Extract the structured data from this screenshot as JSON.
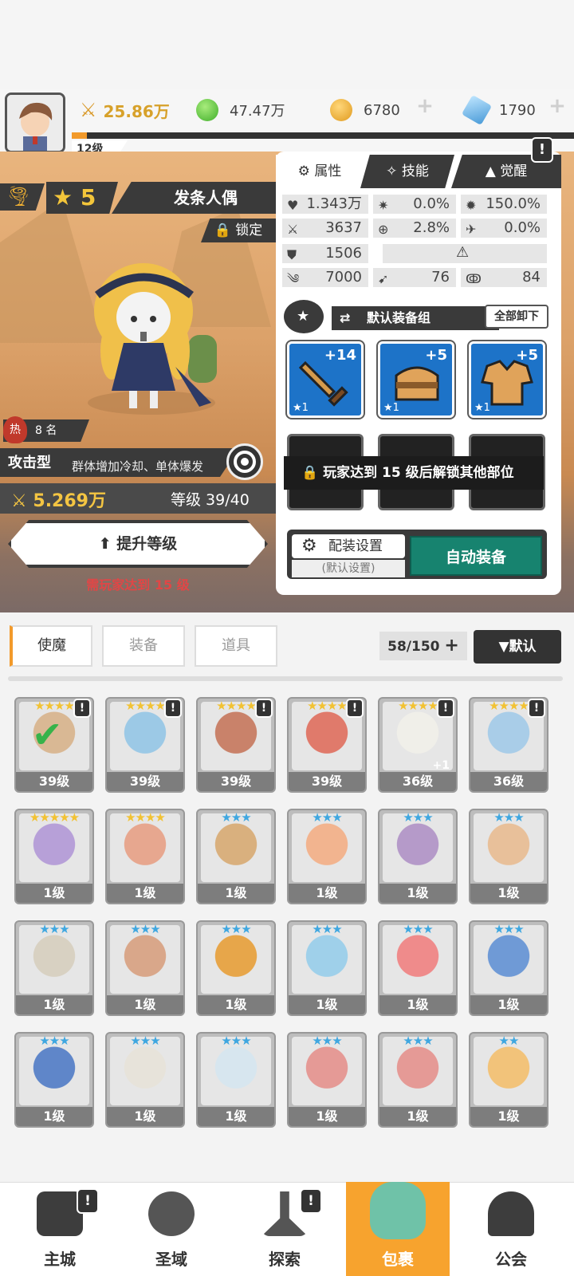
{
  "topbar": {
    "power": "25.86万",
    "gems": "47.47万",
    "gold": "6780",
    "diamond": "1790",
    "player_level": "12级",
    "xp_fraction": 0.03
  },
  "hero": {
    "star": "5",
    "name": "发条人偶",
    "lock_label": "锁定",
    "hot_rank": "8 名",
    "hot_label": "热",
    "type_label": "攻击型",
    "type_desc": "群体增加冷却、单体爆发",
    "power": "5.269万",
    "level_text": "等级 39/40",
    "upgrade_label": "提升等级",
    "upgrade_hint": "需玩家达到 15 级"
  },
  "panel": {
    "tabs": [
      "属性",
      "技能",
      "觉醒"
    ],
    "stats": {
      "hp": "1.343万",
      "s1": "0.0%",
      "s2": "150.0%",
      "atk": "3637",
      "s3": "2.8%",
      "s4": "0.0%",
      "def": "1506",
      "spd": "7000",
      "s5": "76",
      "s6": "84"
    },
    "equip_group": "默认装备组",
    "unequip_all": "全部卸下",
    "equips": [
      {
        "level": "+14",
        "stars": "★1",
        "icon": "sword-icon"
      },
      {
        "level": "+5",
        "stars": "★1",
        "icon": "helmet-icon"
      },
      {
        "level": "+5",
        "stars": "★1",
        "icon": "armor-icon"
      }
    ],
    "lock_msg": "玩家达到 15 级后解锁其他部位",
    "config_label": "配装设置",
    "config_sub": "(默认设置)",
    "auto_equip": "自动装备"
  },
  "inventory": {
    "tabs": [
      "使魔",
      "装备",
      "道具"
    ],
    "count": "58/150",
    "sort": "▼默认",
    "cards": [
      {
        "level": "39级",
        "stars": "★★★★",
        "alert": true,
        "color": "#d9b894",
        "checked": true
      },
      {
        "level": "39级",
        "stars": "★★★★",
        "alert": true,
        "color": "#9cc9e6"
      },
      {
        "level": "39级",
        "stars": "★★★★",
        "alert": true,
        "color": "#c9826a"
      },
      {
        "level": "39级",
        "stars": "★★★★",
        "alert": true,
        "color": "#e07a6b"
      },
      {
        "level": "36级",
        "stars": "★★★★",
        "alert": true,
        "color": "#f0efe9",
        "plus": "+1"
      },
      {
        "level": "36级",
        "stars": "★★★★",
        "alert": true,
        "color": "#a9cde8"
      },
      {
        "level": "1级",
        "stars": "★★★★★",
        "color": "#b7a0d8"
      },
      {
        "level": "1级",
        "stars": "★★★★",
        "color": "#e7a78f"
      },
      {
        "level": "1级",
        "stars": "★★★",
        "color": "#d9b07e"
      },
      {
        "level": "1级",
        "stars": "★★★",
        "color": "#f2b48f"
      },
      {
        "level": "1级",
        "stars": "★★★",
        "color": "#b59ac9"
      },
      {
        "level": "1级",
        "stars": "★★★",
        "color": "#e8c09a"
      },
      {
        "level": "1级",
        "stars": "★★★",
        "color": "#d8d1c2"
      },
      {
        "level": "1级",
        "stars": "★★★",
        "color": "#d9a78a"
      },
      {
        "level": "1级",
        "stars": "★★★",
        "color": "#e7a64a"
      },
      {
        "level": "1级",
        "stars": "★★★",
        "color": "#9fd0ea"
      },
      {
        "level": "1级",
        "stars": "★★★",
        "color": "#ef8b8b"
      },
      {
        "level": "1级",
        "stars": "★★★",
        "color": "#6f9ad6"
      },
      {
        "level": "1级",
        "stars": "★★★",
        "color": "#5f86c9"
      },
      {
        "level": "1级",
        "stars": "★★★",
        "color": "#e7e3da"
      },
      {
        "level": "1级",
        "stars": "★★★",
        "color": "#d7e6ef"
      },
      {
        "level": "1级",
        "stars": "★★★",
        "color": "#e59a96"
      },
      {
        "level": "1级",
        "stars": "★★★",
        "color": "#e59a96"
      },
      {
        "level": "1级",
        "stars": "★★",
        "color": "#f2c37a"
      }
    ]
  },
  "nav": [
    "主城",
    "圣域",
    "探索",
    "包裹",
    "公会"
  ]
}
